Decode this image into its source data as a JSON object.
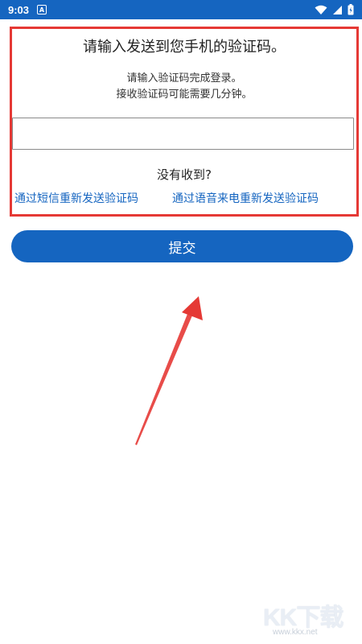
{
  "status_bar": {
    "time": "9:03",
    "notification_letter": "A"
  },
  "form": {
    "heading": "请输入发送到您手机的验证码。",
    "instruction_line1": "请输入验证码完成登录。",
    "instruction_line2": "接收验证码可能需要几分钟。",
    "code_input_value": "",
    "code_input_placeholder": "",
    "not_received": "没有收到?",
    "resend_sms_link": "通过短信重新发送验证码",
    "resend_voice_link": "通过语音来电重新发送验证码"
  },
  "submit_label": "提交",
  "watermark": {
    "brand": "KK下载",
    "url": "www.kkx.net"
  },
  "colors": {
    "primary": "#1565c0",
    "highlight_border": "#e53935",
    "arrow": "#e53935"
  },
  "icons": [
    "wifi-icon",
    "signal-icon",
    "battery-icon"
  ]
}
